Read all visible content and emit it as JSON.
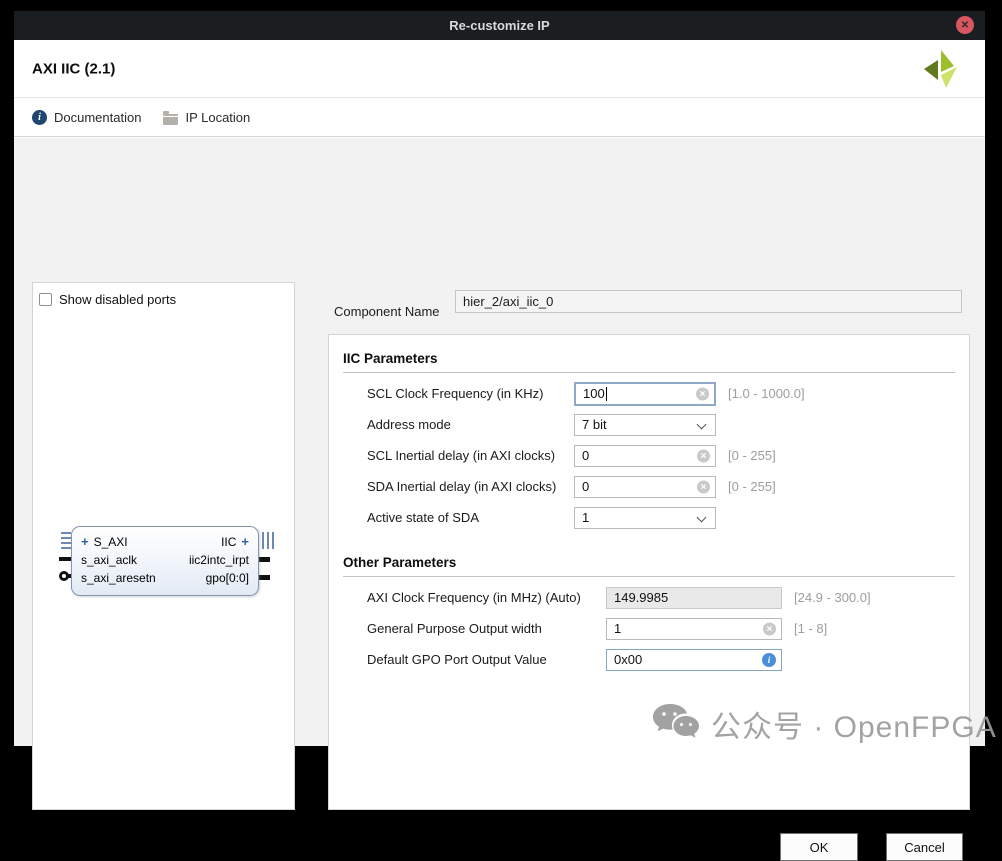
{
  "window": {
    "title": "Re-customize IP"
  },
  "header": {
    "title": "AXI IIC (2.1)"
  },
  "toolbar": {
    "documentation": "Documentation",
    "ip_location": "IP Location"
  },
  "left_panel": {
    "show_disabled_ports": "Show disabled ports",
    "block": {
      "left_ports": [
        {
          "label": "S_AXI",
          "expand": "+"
        },
        {
          "label": "s_axi_aclk"
        },
        {
          "label": "s_axi_aresetn"
        }
      ],
      "right_ports": [
        {
          "label": "IIC",
          "expand": "+"
        },
        {
          "label": "iic2intc_irpt"
        },
        {
          "label": "gpo[0:0]"
        }
      ]
    }
  },
  "component_name": {
    "label": "Component Name",
    "value": "hier_2/axi_iic_0"
  },
  "sections": [
    {
      "title": "IIC Parameters",
      "rows": [
        {
          "label": "SCL Clock Frequency (in KHz)",
          "value": "100",
          "control": "text-focused",
          "hint": "[1.0 - 1000.0]"
        },
        {
          "label": "Address mode",
          "value": "7 bit",
          "control": "select",
          "hint": ""
        },
        {
          "label": "SCL Inertial delay (in AXI clocks)",
          "value": "0",
          "control": "text",
          "hint": "[0 - 255]"
        },
        {
          "label": "SDA Inertial delay (in AXI clocks)",
          "value": "0",
          "control": "text",
          "hint": "[0 - 255]"
        },
        {
          "label": "Active state of SDA",
          "value": "1",
          "control": "select",
          "hint": ""
        }
      ]
    },
    {
      "title": "Other Parameters",
      "rows": [
        {
          "label": "AXI Clock Frequency (in MHz) (Auto)",
          "value": "149.9985",
          "control": "text-disabled",
          "hint": "[24.9 - 300.0]"
        },
        {
          "label": "General Purpose Output width",
          "value": "1",
          "control": "text",
          "hint": "[1 - 8]"
        },
        {
          "label": "Default GPO Port Output Value",
          "value": "0x00",
          "control": "text-info",
          "hint": ""
        }
      ]
    }
  ],
  "footer": {
    "ok": "OK",
    "cancel": "Cancel"
  },
  "watermark": {
    "text": "公众号 · OpenFPGA"
  },
  "icons": {
    "close_glyph": "✕",
    "clear_glyph": "✕",
    "info_glyph": "i"
  },
  "colors": {
    "titlebar_bg": "#1b1e21",
    "close_button_red": "#d95661",
    "focus_border_blue": "#8fa8c8",
    "info_icon_blue": "#4a90d9",
    "block_border_blue": "#8494ad",
    "logo_greens": [
      "#5f7a1d",
      "#9dbf2e",
      "#cfe06b"
    ],
    "watermark_gray": "#9b9b9b"
  }
}
